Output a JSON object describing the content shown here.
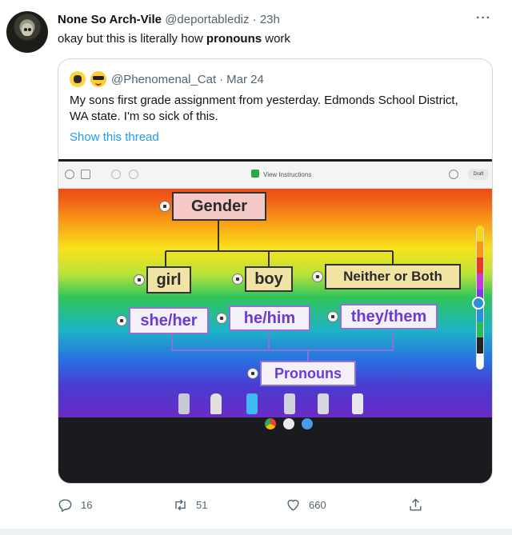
{
  "tweet": {
    "author_name": "None So Arch-Vile",
    "author_handle": "@deportablediz",
    "separator": "·",
    "time": "23h",
    "more_label": "···",
    "text_before": "okay but this is literally how ",
    "text_bold": "pronouns",
    "text_after": " work"
  },
  "quoted": {
    "handle": "@Phenomenal_Cat",
    "separator": "·",
    "date": "Mar 24",
    "text": "My sons first grade assignment from yesterday. Edmonds School District, WA state. I'm so sick of this.",
    "show_thread": "Show this thread"
  },
  "photo": {
    "toolbar_title": "View Instructions",
    "draft_label": "Draft",
    "diagram": {
      "root": "Gender",
      "categories": [
        "girl",
        "boy",
        "Neither or Both"
      ],
      "pronouns": [
        "she/her",
        "he/him",
        "they/them"
      ],
      "bottom": "Pronouns"
    },
    "swatch_colors": [
      "#f6d51f",
      "#f39a1e",
      "#e7362b",
      "#c43ad6",
      "#7b3be0",
      "#2b8ed8",
      "#2eb85c",
      "#222222",
      "#ffffff"
    ]
  },
  "actions": {
    "replies": "16",
    "retweets": "51",
    "likes": "660"
  },
  "colors": {
    "link": "#1d9bf0",
    "muted": "#536471",
    "border": "#cfd9de"
  }
}
